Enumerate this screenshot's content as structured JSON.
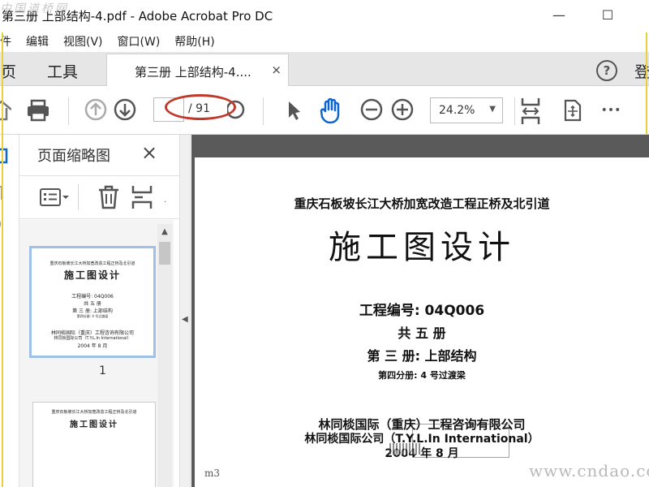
{
  "window": {
    "title": "第三册 上部结构-4.pdf - Adobe Acrobat Pro DC",
    "watermark": "中国道桥网",
    "minimize": "—",
    "maximize": "☐"
  },
  "menu": [
    "件",
    "编辑",
    "视图(V)",
    "窗口(W)",
    "帮助(H)"
  ],
  "tabs": {
    "home": "主页",
    "tools": "工具",
    "document": "第三册 上部结构-4....",
    "close": "×",
    "help": "?",
    "login": "登"
  },
  "toolbar": {
    "page_current": "",
    "page_total": "/ 91",
    "zoom": "24.2%",
    "more": "•••"
  },
  "colors": {
    "accent": "#0d66d0",
    "annotation": "#c0392b",
    "selection": "#9fc1e8",
    "yellow_edge": "#e8d23a"
  },
  "panel": {
    "title": "页面缩略图",
    "close": "×",
    "thumbnail_1_number": "1",
    "thumbnail_1": {
      "line1": "重庆石板坡长江大桥加宽改造工程正桥及北引道",
      "line2": "施工图设计",
      "line3": "工程编号: 04Q006",
      "line4": "共 五 册",
      "line5": "第 三 册: 上部结构",
      "line6": "第四分册: 4 号过渡梁",
      "line7": "林同棪国际（重庆）工程咨询有限公司",
      "line8": "林同棪国际公司（T.Y.L.In International）",
      "line9": "2004 年 8 月"
    },
    "thumbnail_2": {
      "line1": "重庆石板坡长江大桥加宽改造工程正桥及北引道",
      "line2": "施工图设计"
    }
  },
  "document": {
    "project": "重庆石板坡长江大桥加宽改造工程正桥及北引道",
    "heading": "施工图设计",
    "code": "工程编号: 04Q006",
    "volumes": "共 五 册",
    "volume": "第 三 册: 上部结构",
    "subvolume": "第四分册: 4 号过渡梁",
    "company1": "林同棪国际（重庆）工程咨询有限公司",
    "company2": "林同棪国际公司（T.Y.L.In International）",
    "date": "2004 年 8 月",
    "corner_mark": "m3"
  },
  "watermark_bottom": "www.cndao.com"
}
